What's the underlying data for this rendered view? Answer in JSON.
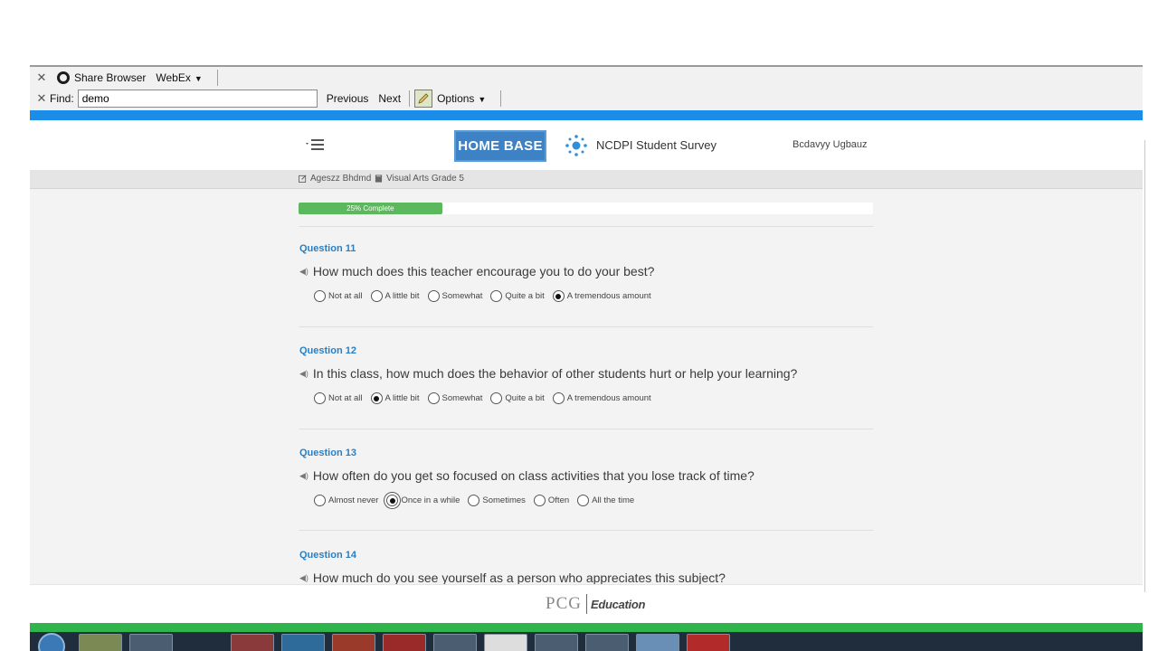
{
  "toolbar": {
    "share_browser_label": "Share Browser",
    "webex_label": "WebEx",
    "find_label": "Find:",
    "find_value": "demo",
    "previous_label": "Previous",
    "next_label": "Next",
    "options_label": "Options"
  },
  "header": {
    "logo_text": "HOME BASE",
    "survey_title": "NCDPI Student Survey",
    "user_name": "Bcdavyy Ugbauz"
  },
  "breadcrumb": {
    "teacher": "Ageszz Bhdmd",
    "course": "Visual Arts Grade 5"
  },
  "progress": {
    "label": "25% Complete",
    "value": 0.25
  },
  "questions": [
    {
      "label": "Question 11",
      "text": "How much does this teacher encourage you to do your best?",
      "options": [
        "Not at all",
        "A little bit",
        "Somewhat",
        "Quite a bit",
        "A tremendous amount"
      ],
      "selected": "A tremendous amount"
    },
    {
      "label": "Question 12",
      "text": "In this class, how much does the behavior of other students hurt or help your learning?",
      "options": [
        "Not at all",
        "A little bit",
        "Somewhat",
        "Quite a bit",
        "A tremendous amount"
      ],
      "selected": "A little bit"
    },
    {
      "label": "Question 13",
      "text": "How often do you get so focused on class activities that you lose track of time?",
      "options": [
        "Almost never",
        "Once in a while",
        "Sometimes",
        "Often",
        "All the time"
      ],
      "selected": "Once in a while"
    },
    {
      "label": "Question 14",
      "text": "How much do you see yourself as a person who appreciates this subject?"
    }
  ],
  "footer": {
    "brand": "PCG",
    "brand_sub": "Education"
  },
  "colors": {
    "accent_blue": "#1b8ce8",
    "question_blue": "#2a7fc2",
    "progress_green": "#5cb85c",
    "footer_green": "#2fb54b"
  },
  "icons": {
    "close": "close-icon",
    "globe": "globe-icon",
    "pencil": "pencil-icon",
    "menu": "menu-icon",
    "speaker": "speaker-icon"
  }
}
